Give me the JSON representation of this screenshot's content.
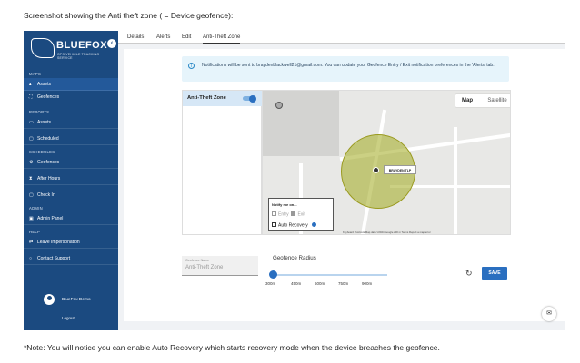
{
  "caption_top": "Screenshot showing the Anti theft zone ( = Device geofence):",
  "caption_bottom": "*Note: You will notice you can enable Auto Recovery which starts recovery mode when the device breaches the geofence.",
  "sidebar": {
    "logo_text": "BLUEFOX",
    "logo_sub": "GPS VEHICLE TRACKING SERVICE",
    "sections": {
      "maps": "MAPS",
      "reports": "REPORTS",
      "schedules": "SCHEDULES",
      "admin": "ADMIN",
      "help": "HELP"
    },
    "items": [
      {
        "label": "Assets",
        "icon": "chart-icon"
      },
      {
        "label": "Geofences",
        "icon": "fence-icon"
      },
      {
        "label": "Assets",
        "icon": "car-icon"
      },
      {
        "label": "Scheduled",
        "icon": "calendar-icon"
      },
      {
        "label": "Geofences",
        "icon": "gear-icon"
      },
      {
        "label": "After Hours",
        "icon": "hourglass-icon"
      },
      {
        "label": "Check In",
        "icon": "calendar-icon"
      },
      {
        "label": "Admin Panel",
        "icon": "panel-icon"
      },
      {
        "label": "Leave Impersonation",
        "icon": "user-swap-icon"
      },
      {
        "label": "Contact Support",
        "icon": "support-icon"
      }
    ],
    "user_name": "BlueFox Demo",
    "logout": "Logout"
  },
  "tabs": [
    "Details",
    "Alerts",
    "Edit",
    "Anti-Theft Zone"
  ],
  "notice": "Notifications will be sent to braydenblackwell21@gmail.com. You can update your Geofence Entry / Exit notification preferences in the 'Alerts' tab.",
  "panel": {
    "title": "Anti-Theft Zone",
    "toggle_on": true
  },
  "map": {
    "type_map": "Map",
    "type_satellite": "Satellite",
    "zoom_in": "+",
    "zoom_out": "−",
    "pin_label": "BRAYDEN TLP",
    "attribution": "Keyboard shortcuts   Map data ©2024 Google   200 m   Terms   Report a map error",
    "notify": {
      "title": "Notify me on...",
      "entry": "Entry",
      "exit": "Exit",
      "auto_recovery": "Auto Recovery"
    }
  },
  "geofence": {
    "name_label": "Geofence Name",
    "name_value": "Anti-Theft Zone",
    "radius_title": "Geofence Radius",
    "ticks": [
      "300m",
      "450m",
      "600m",
      "750m",
      "900m"
    ],
    "selected_index": 0,
    "save_label": "SAVE"
  },
  "colors": {
    "sidebar": "#1b4a80",
    "accent": "#2a6fc0",
    "geofence_fill": "#a0aa1e"
  }
}
